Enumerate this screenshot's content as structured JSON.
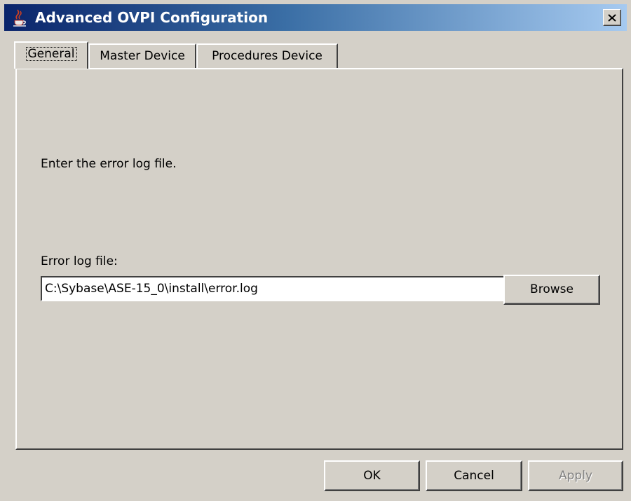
{
  "window": {
    "title": "Advanced OVPI Configuration",
    "title_icon": "java-coffee-cup-icon",
    "close_icon": "close-icon"
  },
  "tabs": [
    {
      "label": "General",
      "active": true
    },
    {
      "label": "Master Device",
      "active": false
    },
    {
      "label": "Procedures Device",
      "active": false
    }
  ],
  "general": {
    "instruction": "Enter the error log file.",
    "error_log_label": "Error log file:",
    "error_log_value": "C:\\Sybase\\ASE-15_0\\install\\error.log",
    "browse_label": "Browse"
  },
  "footer": {
    "ok_label": "OK",
    "cancel_label": "Cancel",
    "apply_label": "Apply",
    "apply_enabled": false
  }
}
